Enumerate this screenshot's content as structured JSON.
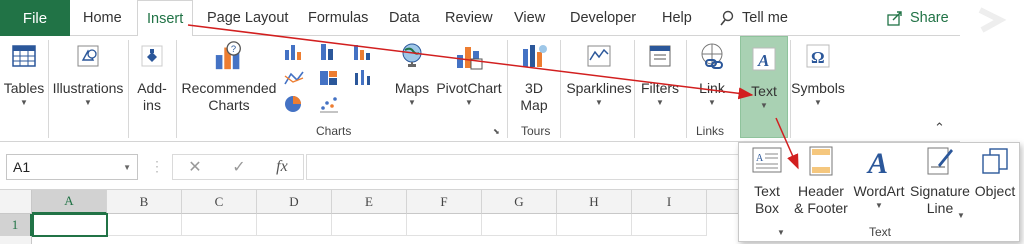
{
  "tabs": {
    "file": "File",
    "home": "Home",
    "insert": "Insert",
    "page_layout": "Page Layout",
    "formulas": "Formulas",
    "data": "Data",
    "review": "Review",
    "view": "View",
    "developer": "Developer",
    "help": "Help",
    "tell_me": "Tell me",
    "share": "Share"
  },
  "ribbon": {
    "tables": "Tables",
    "illustrations": "Illustrations",
    "addins_1": "Add-",
    "addins_2": "ins",
    "recommended_1": "Recommended",
    "recommended_2": "Charts",
    "maps": "Maps",
    "pivotchart": "PivotChart",
    "map3d_1": "3D",
    "map3d_2": "Map",
    "sparklines": "Sparklines",
    "filters": "Filters",
    "link": "Link",
    "text": "Text",
    "symbols": "Symbols",
    "group_charts": "Charts",
    "group_tours": "Tours",
    "group_links": "Links"
  },
  "formula_bar": {
    "name_box": "A1",
    "cancel": "✕",
    "enter": "✓",
    "fx": "fx"
  },
  "grid": {
    "columns": [
      "A",
      "B",
      "C",
      "D",
      "E",
      "F",
      "G",
      "H",
      "I"
    ],
    "row1": "1"
  },
  "text_menu": {
    "textbox_1": "Text",
    "textbox_2": "Box",
    "header_1": "Header",
    "header_2": "& Footer",
    "wordart": "WordArt",
    "signature_1": "Signature",
    "signature_2": "Line",
    "object": "Object",
    "group_label": "Text"
  },
  "colors": {
    "accent": "#217346",
    "highlight": "#a9d1b3",
    "arrow": "#d21f1f"
  }
}
